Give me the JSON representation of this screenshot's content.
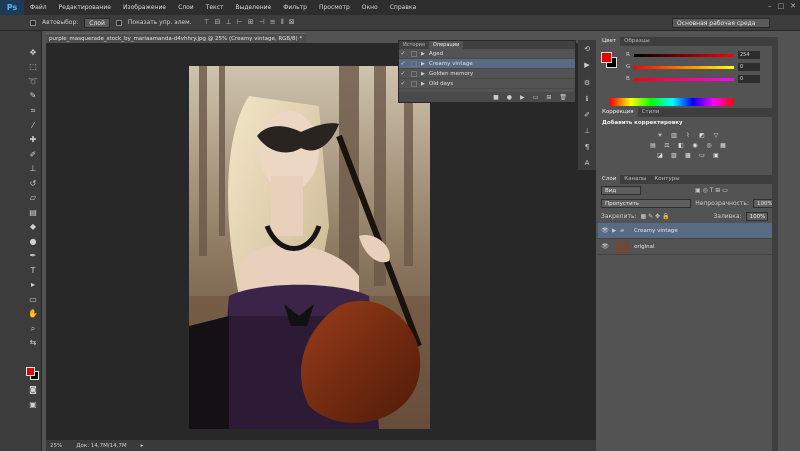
{
  "app": {
    "logo": "Ps",
    "menu": [
      "Файл",
      "Редактирование",
      "Изображение",
      "Слои",
      "Текст",
      "Выделение",
      "Фильтр",
      "Просмотр",
      "Окно",
      "Справка"
    ],
    "window_controls": [
      "–",
      "□",
      "✕"
    ]
  },
  "options_bar": {
    "autoselect_label": "Автовыбор:",
    "autoselect_value": "Слой",
    "show_controls_label": "Показать упр. элем.",
    "workspace": "Основная рабочая среда"
  },
  "document": {
    "tab_title": "purple_masquerade_stock_by_mariaamanda-d4vhhry.jpg @ 25% (Creamy vintage, RGB/8) *",
    "close": "×",
    "zoom": "25%",
    "doc_info": "Док: 14,7M/14,7M"
  },
  "float_panel": {
    "tabs": [
      "История",
      "Операции"
    ],
    "actions": [
      {
        "name": "Aged",
        "checked": true,
        "selected": false
      },
      {
        "name": "Creamy vintage",
        "checked": true,
        "selected": true
      },
      {
        "name": "Golden memory",
        "checked": true,
        "selected": false
      },
      {
        "name": "Old days",
        "checked": true,
        "selected": false
      }
    ]
  },
  "color_panel": {
    "tabs": [
      "Цвет",
      "Образцы"
    ],
    "r_label": "R",
    "r_value": "254",
    "g_label": "G",
    "g_value": "0",
    "b_label": "B",
    "b_value": "0",
    "fg_color": "#e00000"
  },
  "adjustments": {
    "tabs": [
      "Коррекция",
      "Стили"
    ],
    "title": "Добавить корректировку"
  },
  "layers": {
    "tabs": [
      "Слои",
      "Каналы",
      "Контуры"
    ],
    "filter_label": "Вид",
    "blend_mode": "Пропустить",
    "opacity_label": "Непрозрачность:",
    "opacity_value": "100%",
    "lock_label": "Закрепить:",
    "fill_label": "Заливка:",
    "fill_value": "100%",
    "items": [
      {
        "name": "Creamy vintage",
        "type": "group",
        "selected": true
      },
      {
        "name": "original",
        "type": "image",
        "selected": false
      }
    ]
  }
}
